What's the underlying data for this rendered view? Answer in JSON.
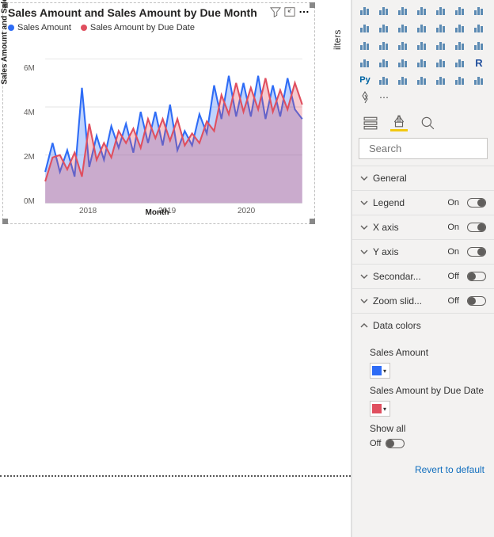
{
  "filters_tab_label": "ilters",
  "visual_header": {
    "title": "Sales Amount and Sales Amount by Due Month",
    "title_visible": "Sales Amount and Sales Amount by Due Month",
    "filter_icon": "filter-icon",
    "focus_icon": "focus-mode-icon",
    "more_icon": "more-options-icon"
  },
  "legend": [
    {
      "label": "Sales Amount",
      "color": "#2e6cf6"
    },
    {
      "label": "Sales Amount by Due Date",
      "color": "#e04f5f"
    }
  ],
  "axes": {
    "y_label": "Sales Amount and Sales A...",
    "x_label": "Month",
    "y_ticks": [
      "0M",
      "2M",
      "4M",
      "6M"
    ],
    "x_ticks": [
      "2018",
      "2019",
      "2020"
    ]
  },
  "chart_data": {
    "type": "area",
    "xlabel": "Month",
    "ylabel": "Sales Amount and Sales Amount by Due Date",
    "ylim": [
      0,
      6000000
    ],
    "x": [
      "2017-07",
      "2017-08",
      "2017-09",
      "2017-10",
      "2017-11",
      "2017-12",
      "2018-01",
      "2018-02",
      "2018-03",
      "2018-04",
      "2018-05",
      "2018-06",
      "2018-07",
      "2018-08",
      "2018-09",
      "2018-10",
      "2018-11",
      "2018-12",
      "2019-01",
      "2019-02",
      "2019-03",
      "2019-04",
      "2019-05",
      "2019-06",
      "2019-07",
      "2019-08",
      "2019-09",
      "2019-10",
      "2019-11",
      "2019-12",
      "2020-01",
      "2020-02",
      "2020-03",
      "2020-04",
      "2020-05",
      "2020-06"
    ],
    "series": [
      {
        "name": "Sales Amount",
        "color": "#2e6cf6",
        "values": [
          1300000,
          2500000,
          1300000,
          2200000,
          1100000,
          4800000,
          1500000,
          2800000,
          1800000,
          3200000,
          2300000,
          3300000,
          2100000,
          3800000,
          2500000,
          3800000,
          2400000,
          4100000,
          2200000,
          3000000,
          2400000,
          3700000,
          2900000,
          4900000,
          3500000,
          5300000,
          3600000,
          5000000,
          3600000,
          5300000,
          3500000,
          4900000,
          3600000,
          5200000,
          3900000,
          3500000
        ]
      },
      {
        "name": "Sales Amount by Due Date",
        "color": "#e04f5f",
        "values": [
          900000,
          1900000,
          2000000,
          1400000,
          2100000,
          1100000,
          3300000,
          1800000,
          2500000,
          1900000,
          3000000,
          2500000,
          3100000,
          2300000,
          3500000,
          2700000,
          3500000,
          2600000,
          3500000,
          2400000,
          2900000,
          2500000,
          3400000,
          3000000,
          4500000,
          3700000,
          5000000,
          3800000,
          4800000,
          3900000,
          5200000,
          3800000,
          4700000,
          3900000,
          5000000,
          4100000
        ]
      }
    ]
  },
  "viz_picker_icons": [
    "stacked-bar",
    "stacked-column",
    "clustered-bar",
    "clustered-column",
    "hundred-bar",
    "hundred-column",
    "line",
    "area",
    "stacked-area",
    "line-stacked",
    "line-clustered",
    "ribbon",
    "waterfall",
    "funnel",
    "scatter",
    "pie",
    "donut",
    "treemap",
    "map",
    "filled-map",
    "gauge",
    "card",
    "multi-row-card",
    "kpi",
    "slicer",
    "table",
    "matrix",
    "r-visual",
    "python-visual",
    "key-influencers",
    "decomposition-tree",
    "qna",
    "paginated",
    "arcgis",
    "powerapps",
    "get-more",
    "more-options"
  ],
  "format_tabs": {
    "fields": "Fields",
    "format": "Format",
    "analytics": "Analytics"
  },
  "search": {
    "placeholder": "Search"
  },
  "format_groups": [
    {
      "key": "general",
      "label": "General",
      "expanded": false,
      "toggle": null
    },
    {
      "key": "legend",
      "label": "Legend",
      "expanded": false,
      "toggle": "On"
    },
    {
      "key": "xaxis",
      "label": "X axis",
      "expanded": false,
      "toggle": "On"
    },
    {
      "key": "yaxis",
      "label": "Y axis",
      "expanded": false,
      "toggle": "On"
    },
    {
      "key": "secondary",
      "label": "Secondar...",
      "expanded": false,
      "toggle": "Off"
    },
    {
      "key": "zoom",
      "label": "Zoom slid...",
      "expanded": false,
      "toggle": "Off"
    },
    {
      "key": "datacolors",
      "label": "Data colors",
      "expanded": true,
      "toggle": null
    }
  ],
  "data_colors": {
    "items": [
      {
        "label": "Sales Amount",
        "color": "#2e6cf6"
      },
      {
        "label": "Sales Amount by Due Date",
        "color": "#e04f5f"
      }
    ],
    "show_all_label": "Show all",
    "show_all_state": "Off"
  },
  "revert_label": "Revert to default"
}
